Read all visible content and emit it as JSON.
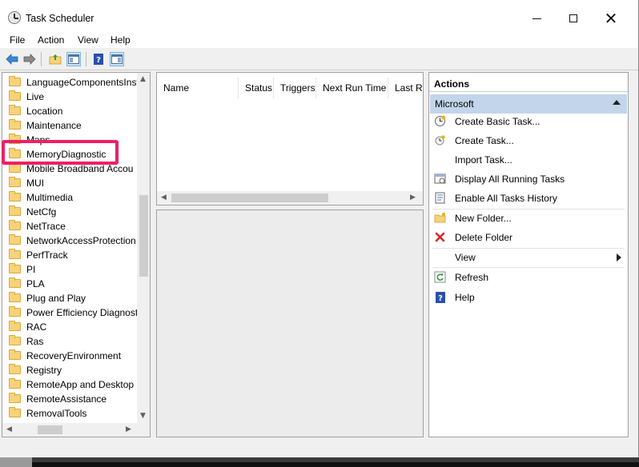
{
  "window": {
    "title": "Task Scheduler"
  },
  "menu": [
    "File",
    "Action",
    "View",
    "Help"
  ],
  "tree": {
    "items": [
      "LanguageComponentsInst",
      "Live",
      "Location",
      "Maintenance",
      "Maps",
      "MemoryDiagnostic",
      "Mobile Broadband Accou",
      "MUI",
      "Multimedia",
      "NetCfg",
      "NetTrace",
      "NetworkAccessProtection",
      "PerfTrack",
      "PI",
      "PLA",
      "Plug and Play",
      "Power Efficiency Diagnost",
      "RAC",
      "Ras",
      "RecoveryEnvironment",
      "Registry",
      "RemoteApp and Desktop C",
      "RemoteAssistance",
      "RemovalTools"
    ],
    "selected": "MemoryDiagnostic"
  },
  "task_list": {
    "columns": [
      "Name",
      "Status",
      "Triggers",
      "Next Run Time",
      "Last R"
    ]
  },
  "actions": {
    "header": "Actions",
    "group": "Microsoft",
    "items": [
      {
        "label": "Create Basic Task...",
        "icon": "create-basic-task-icon"
      },
      {
        "label": "Create Task...",
        "icon": "create-task-icon"
      },
      {
        "label": "Import Task...",
        "icon": "none"
      },
      {
        "label": "Display All Running Tasks",
        "icon": "running-tasks-icon"
      },
      {
        "label": "Enable All Tasks History",
        "icon": "history-icon"
      },
      {
        "label": "New Folder...",
        "icon": "new-folder-icon"
      },
      {
        "label": "Delete Folder",
        "icon": "delete-icon"
      },
      {
        "label": "View",
        "icon": "none"
      },
      {
        "label": "Refresh",
        "icon": "refresh-icon"
      },
      {
        "label": "Help",
        "icon": "help-icon"
      }
    ]
  },
  "colors": {
    "highlight": "#ee1f66",
    "group_header": "#c3d5ea",
    "delete_icon": "#d9262a",
    "help_icon": "#2a4fb0"
  }
}
